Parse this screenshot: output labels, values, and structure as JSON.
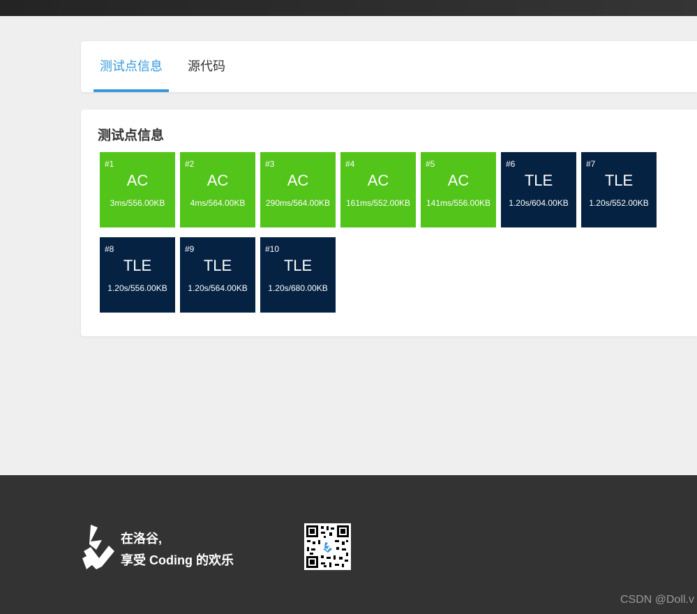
{
  "tabs": [
    {
      "label": "测试点信息",
      "active": true
    },
    {
      "label": "源代码",
      "active": false
    }
  ],
  "section": {
    "title": "测试点信息"
  },
  "testcases": [
    {
      "id": "#1",
      "status": "AC",
      "detail": "3ms/556.00KB"
    },
    {
      "id": "#2",
      "status": "AC",
      "detail": "4ms/564.00KB"
    },
    {
      "id": "#3",
      "status": "AC",
      "detail": "290ms/564.00KB"
    },
    {
      "id": "#4",
      "status": "AC",
      "detail": "161ms/552.00KB"
    },
    {
      "id": "#5",
      "status": "AC",
      "detail": "141ms/556.00KB"
    },
    {
      "id": "#6",
      "status": "TLE",
      "detail": "1.20s/604.00KB"
    },
    {
      "id": "#7",
      "status": "TLE",
      "detail": "1.20s/552.00KB"
    },
    {
      "id": "#8",
      "status": "TLE",
      "detail": "1.20s/556.00KB"
    },
    {
      "id": "#9",
      "status": "TLE",
      "detail": "1.20s/564.00KB"
    },
    {
      "id": "#10",
      "status": "TLE",
      "detail": "1.20s/680.00KB"
    }
  ],
  "colors": {
    "accent": "#3498db",
    "ac": "#52c41a",
    "tle": "#052242",
    "footer": "#333333"
  },
  "footer": {
    "slogan_line1": "在洛谷,",
    "slogan_line2": "享受 Coding 的欢乐",
    "logo_icon": "luogu-logo-icon",
    "qr_icon": "qr-code-icon"
  },
  "watermark": "CSDN @Doll.v"
}
